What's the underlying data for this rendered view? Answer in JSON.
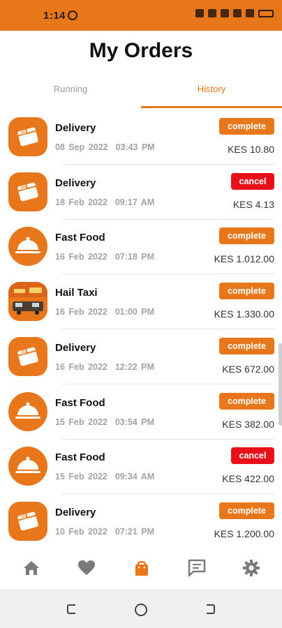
{
  "status_bar": {
    "time": "1:14"
  },
  "header": {
    "title": "My Orders"
  },
  "tabs": [
    {
      "label": "Running",
      "active": false
    },
    {
      "label": "History",
      "active": true
    }
  ],
  "orders": [
    {
      "icon": "box-icon",
      "title": "Delivery",
      "date": "08 Sep 2022  03:43 PM",
      "status": "complete",
      "price": "KES 10.80"
    },
    {
      "icon": "box-icon",
      "title": "Delivery",
      "date": "18 Feb 2022  09:17 AM",
      "status": "cancel",
      "price": "KES 4.13"
    },
    {
      "icon": "food-cloche-icon",
      "title": "Fast Food",
      "date": "16 Feb 2022  07:18 PM",
      "status": "complete",
      "price": "KES 1.012.00"
    },
    {
      "icon": "taxi-image-icon",
      "title": "Hail Taxi",
      "date": "16 Feb 2022  01:00 PM",
      "status": "complete",
      "price": "KES 1.330.00"
    },
    {
      "icon": "box-icon",
      "title": "Delivery",
      "date": "16 Feb 2022  12:22 PM",
      "status": "complete",
      "price": "KES 672.00"
    },
    {
      "icon": "food-cloche-icon",
      "title": "Fast Food",
      "date": "15 Feb 2022  03:54 PM",
      "status": "complete",
      "price": "KES 382.00"
    },
    {
      "icon": "food-cloche-icon",
      "title": "Fast Food",
      "date": "15 Feb 2022  09:34 AM",
      "status": "cancel",
      "price": "KES 422.00"
    },
    {
      "icon": "box-icon",
      "title": "Delivery",
      "date": "10 Feb 2022  07:21 PM",
      "status": "complete",
      "price": "KES 1.200.00"
    }
  ],
  "bottom_nav": [
    {
      "icon": "home-icon",
      "active": false
    },
    {
      "icon": "heart-icon",
      "active": false
    },
    {
      "icon": "shopping-bag-icon",
      "active": true
    },
    {
      "icon": "chat-icon",
      "active": false
    },
    {
      "icon": "gear-icon",
      "active": false
    }
  ],
  "colors": {
    "accent": "#E8761B",
    "cancel": "#E8101B",
    "inactive_icon": "#7a7a7a"
  }
}
